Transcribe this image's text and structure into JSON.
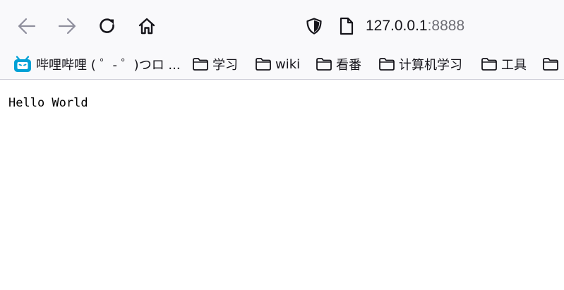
{
  "toolbar": {
    "back_icon": "arrow-left-icon",
    "forward_icon": "arrow-right-icon",
    "reload_icon": "reload-icon",
    "home_icon": "home-icon",
    "url_host": "127.0.0.1",
    "url_port": ":8888",
    "icon_active_color": "#15141a",
    "icon_disabled_color": "#8f8f9d"
  },
  "bookmarks": {
    "items": [
      {
        "label": "哔哩哔哩 ( ゜- ゜)つロ ...",
        "icon": "bilibili-icon"
      },
      {
        "label": "学习",
        "icon": "folder-icon"
      },
      {
        "label": "wiki",
        "icon": "folder-icon"
      },
      {
        "label": "看番",
        "icon": "folder-icon"
      },
      {
        "label": "计算机学习",
        "icon": "folder-icon"
      },
      {
        "label": "工具",
        "icon": "folder-icon"
      },
      {
        "label": "",
        "icon": "folder-icon"
      }
    ],
    "bilibili_color": "#00a1d6"
  },
  "page": {
    "body_text": "Hello World"
  }
}
